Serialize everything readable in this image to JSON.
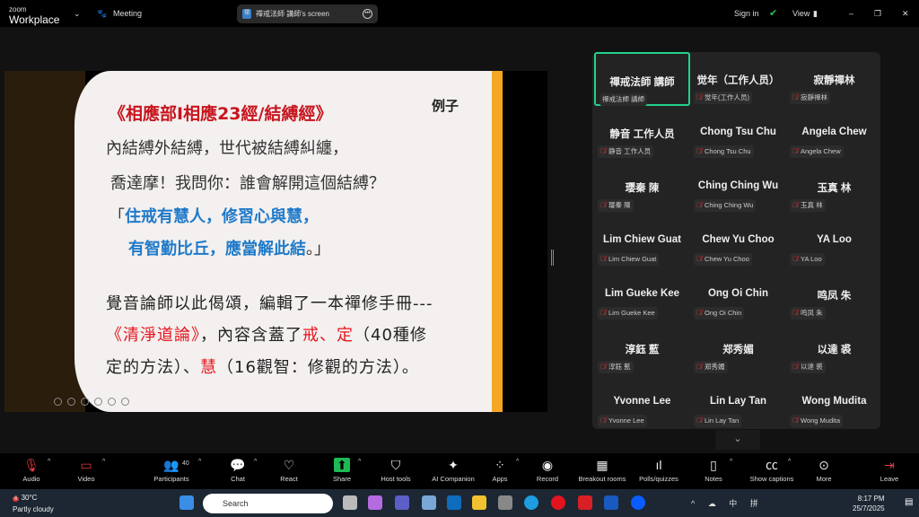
{
  "topbar": {
    "brand_small": "zoom",
    "brand": "Workplace",
    "meeting": "Meeting",
    "screen_avatar": "禪",
    "screen_title": "禪戒法師 講師's screen",
    "sign_in": "Sign in",
    "view": "View"
  },
  "slide": {
    "title": "《相應部I相應23經/結縛經》",
    "tag": "例子",
    "line1": "內結縛外結縛，世代被結縛糾纏，",
    "line2": "喬達摩！我問你：誰會解開這個結縛？",
    "line3_open": "「",
    "line3": "住戒有慧人，修習心與慧，",
    "line4": "有智勤比丘，應當解此結",
    "line4_close": "。」",
    "line5": "覺音論師以此偈頌，編輯了一本禪修手冊---",
    "line6_a": "《清淨道論》",
    "line6_b": "，內容含蓋了",
    "line6_c": "戒、定",
    "line6_d": "（40種修",
    "line7_a": "定的方法）、",
    "line7_b": "慧",
    "line7_c": "（16觀智：修觀的方法）。"
  },
  "participants": [
    {
      "name": "禪戒法師 講師",
      "label": "禪戒法師 講師",
      "active": true,
      "muted": false
    },
    {
      "name": "觉年（工作人员）",
      "label": "觉年(工作人员)",
      "muted": true
    },
    {
      "name": "寂靜禪林",
      "label": "寂靜禪林",
      "muted": true
    },
    {
      "name": "静音 工作人员",
      "label": "静音 工作人员",
      "muted": true
    },
    {
      "name": "Chong Tsu Chu",
      "label": "Chong Tsu Chu",
      "muted": true
    },
    {
      "name": "Angela Chew",
      "label": "Angela Chew",
      "muted": true
    },
    {
      "name": "璎秦 陳",
      "label": "璎秦 陳",
      "muted": true
    },
    {
      "name": "Ching Ching Wu",
      "label": "Ching Ching Wu",
      "muted": true
    },
    {
      "name": "玉真 林",
      "label": "玉真 林",
      "muted": true
    },
    {
      "name": "Lim Chiew Guat",
      "label": "Lim Chiew Guat",
      "muted": true
    },
    {
      "name": "Chew Yu Choo",
      "label": "Chew Yu Choo",
      "muted": true
    },
    {
      "name": "YA Loo",
      "label": "YA Loo",
      "muted": true
    },
    {
      "name": "Lim Gueke Kee",
      "label": "Lim Gueke Kee",
      "muted": true
    },
    {
      "name": "Ong Oi Chin",
      "label": "Ong Oi Chin",
      "muted": true
    },
    {
      "name": "鸣凤 朱",
      "label": "鸣凤 朱",
      "muted": true
    },
    {
      "name": "淳鈺 藍",
      "label": "淳鈺 藍",
      "muted": true
    },
    {
      "name": "郑秀媚",
      "label": "郑秀媚",
      "muted": true
    },
    {
      "name": "以達 裘",
      "label": "以達 裘",
      "muted": true
    },
    {
      "name": "Yvonne Lee",
      "label": "Yvonne Lee",
      "muted": true
    },
    {
      "name": "Lin Lay Tan",
      "label": "Lin Lay Tan",
      "muted": true
    },
    {
      "name": "Wong Mudita",
      "label": "Wong Mudita",
      "muted": true
    }
  ],
  "toolbar": [
    {
      "label": "Audio",
      "icon": "mic-off-icon",
      "glyph": "🎙",
      "caret": true
    },
    {
      "label": "Video",
      "icon": "video-off-icon",
      "glyph": "▭",
      "caret": true
    },
    {
      "label": "Participants",
      "icon": "participants-icon",
      "glyph": "👥",
      "caret": true,
      "count": "40"
    },
    {
      "label": "Chat",
      "icon": "chat-icon",
      "glyph": "💬",
      "caret": true
    },
    {
      "label": "React",
      "icon": "heart-icon",
      "glyph": "♡"
    },
    {
      "label": "Share",
      "icon": "share-icon",
      "glyph": "⬆",
      "caret": true
    },
    {
      "label": "Host tools",
      "icon": "shield-icon",
      "glyph": "⛉"
    },
    {
      "label": "AI Companion",
      "icon": "sparkle-icon",
      "glyph": "✦"
    },
    {
      "label": "Apps",
      "icon": "apps-icon",
      "glyph": "⁘",
      "caret": true
    },
    {
      "label": "Record",
      "icon": "record-icon",
      "glyph": "◉"
    },
    {
      "label": "Breakout rooms",
      "icon": "breakout-icon",
      "glyph": "▦"
    },
    {
      "label": "Polls/quizzes",
      "icon": "polls-icon",
      "glyph": "ıl"
    },
    {
      "label": "Notes",
      "icon": "notes-icon",
      "glyph": "▯",
      "caret": true
    },
    {
      "label": "Show captions",
      "icon": "cc-icon",
      "glyph": "㏄",
      "caret": true
    },
    {
      "label": "More",
      "icon": "more-icon",
      "glyph": "⊙"
    },
    {
      "label": "Leave",
      "icon": "leave-icon",
      "glyph": "⇥"
    }
  ],
  "taskbar": {
    "weather_badge": "6",
    "temp": "30°C",
    "condition": "Partly cloudy",
    "search": "Search",
    "tray": "^ ☁ 中 拼",
    "time": "8:17 PM",
    "date": "25/7/2025"
  },
  "colors": {
    "active_speaker": "#23d18b",
    "muted": "#e0393e",
    "share": "#1db954"
  }
}
